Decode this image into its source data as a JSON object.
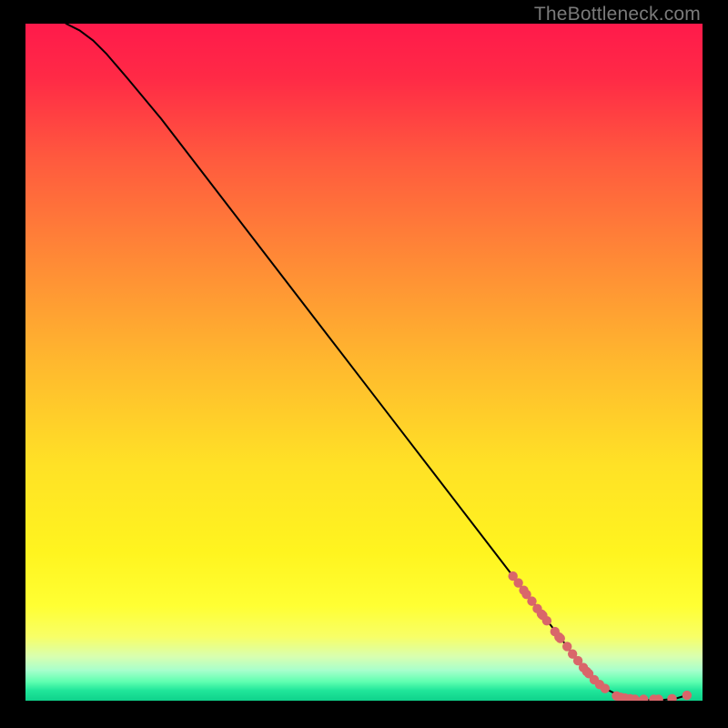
{
  "watermark": "TheBottleneck.com",
  "chart_data": {
    "type": "line",
    "title": "",
    "xlabel": "",
    "ylabel": "",
    "xlim": [
      0,
      100
    ],
    "ylim": [
      0,
      100
    ],
    "grid": false,
    "legend": false,
    "background": {
      "type": "vertical_gradient",
      "stops": [
        {
          "offset": 0.0,
          "color": "#ff1a4b"
        },
        {
          "offset": 0.08,
          "color": "#ff2a46"
        },
        {
          "offset": 0.2,
          "color": "#ff5a3e"
        },
        {
          "offset": 0.35,
          "color": "#ff8a36"
        },
        {
          "offset": 0.5,
          "color": "#ffb82e"
        },
        {
          "offset": 0.65,
          "color": "#ffe126"
        },
        {
          "offset": 0.78,
          "color": "#fff41f"
        },
        {
          "offset": 0.86,
          "color": "#ffff33"
        },
        {
          "offset": 0.905,
          "color": "#f8ff66"
        },
        {
          "offset": 0.935,
          "color": "#d8ffb0"
        },
        {
          "offset": 0.955,
          "color": "#a8ffcc"
        },
        {
          "offset": 0.972,
          "color": "#5fffb0"
        },
        {
          "offset": 0.985,
          "color": "#20e69a"
        },
        {
          "offset": 1.0,
          "color": "#0fd28b"
        }
      ]
    },
    "series": [
      {
        "name": "bottleneck-curve",
        "stroke": "#000000",
        "stroke_width": 2,
        "x": [
          6,
          8,
          10,
          12,
          15,
          20,
          25,
          30,
          35,
          40,
          45,
          50,
          55,
          60,
          65,
          70,
          75,
          80,
          83,
          86,
          88,
          90,
          92,
          94,
          96,
          98
        ],
        "values": [
          100,
          99,
          97.5,
          95.5,
          92,
          86,
          79.5,
          73,
          66.5,
          60,
          53.5,
          47,
          40.5,
          34,
          27.5,
          21,
          14.5,
          8,
          4.2,
          1.6,
          0.6,
          0.2,
          0.1,
          0.1,
          0.3,
          0.9
        ]
      }
    ],
    "scatter": {
      "name": "sample-points",
      "color": "#d9666a",
      "radius": 5.2,
      "points": [
        {
          "x": 72.0,
          "y": 18.4
        },
        {
          "x": 72.8,
          "y": 17.4
        },
        {
          "x": 73.6,
          "y": 16.3
        },
        {
          "x": 74.0,
          "y": 15.7
        },
        {
          "x": 74.8,
          "y": 14.7
        },
        {
          "x": 75.6,
          "y": 13.6
        },
        {
          "x": 76.2,
          "y": 12.8
        },
        {
          "x": 76.4,
          "y": 12.6
        },
        {
          "x": 77.0,
          "y": 11.8
        },
        {
          "x": 78.2,
          "y": 10.2
        },
        {
          "x": 78.8,
          "y": 9.4
        },
        {
          "x": 79.0,
          "y": 9.2
        },
        {
          "x": 80.0,
          "y": 8.0
        },
        {
          "x": 80.8,
          "y": 6.9
        },
        {
          "x": 81.6,
          "y": 5.9
        },
        {
          "x": 82.4,
          "y": 4.9
        },
        {
          "x": 82.9,
          "y": 4.3
        },
        {
          "x": 83.2,
          "y": 4.0
        },
        {
          "x": 84.0,
          "y": 3.1
        },
        {
          "x": 84.8,
          "y": 2.4
        },
        {
          "x": 85.6,
          "y": 1.8
        },
        {
          "x": 87.3,
          "y": 0.7
        },
        {
          "x": 87.9,
          "y": 0.5
        },
        {
          "x": 88.5,
          "y": 0.4
        },
        {
          "x": 89.3,
          "y": 0.3
        },
        {
          "x": 90.0,
          "y": 0.2
        },
        {
          "x": 91.3,
          "y": 0.2
        },
        {
          "x": 92.8,
          "y": 0.2
        },
        {
          "x": 93.5,
          "y": 0.2
        },
        {
          "x": 95.5,
          "y": 0.3
        },
        {
          "x": 97.7,
          "y": 0.8
        }
      ]
    }
  }
}
